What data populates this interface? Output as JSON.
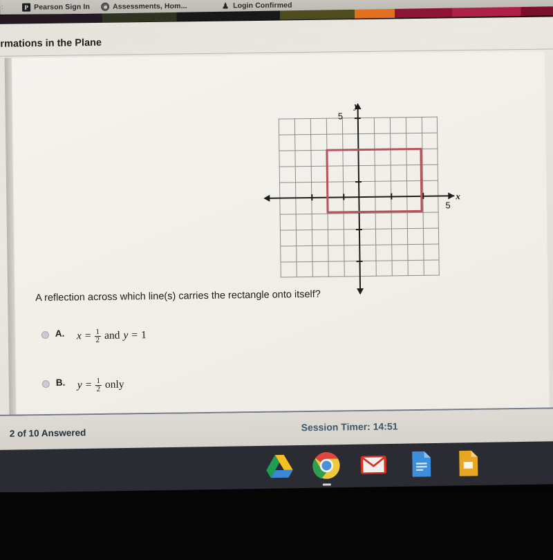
{
  "browser": {
    "tabs": [
      {
        "label": "Pearson Sign In",
        "favicon": "pearson-p-icon",
        "favicon_glyph": "P"
      },
      {
        "label": "Assessments, Hom...",
        "favicon": "globe-circle-icon",
        "favicon_glyph": ""
      },
      {
        "label": "Login Confirmed",
        "favicon": "person-icon",
        "favicon_glyph": "♟"
      }
    ]
  },
  "header": {
    "title": "rmations in the Plane"
  },
  "graph": {
    "y_axis_label": "y",
    "x_axis_label": "x",
    "y_tick_label": "5",
    "x_tick_label": "5",
    "grid_cells_x": 10,
    "grid_cells_y": 10,
    "rect_color": "#b5535c",
    "rect": {
      "x_min": -2,
      "x_max": 4,
      "y_min": -1,
      "y_max": 2
    }
  },
  "chart_data": {
    "type": "scatter",
    "title": "",
    "xlabel": "x",
    "ylabel": "y",
    "xlim": [
      -5,
      5
    ],
    "ylim": [
      -5,
      5
    ],
    "grid": true,
    "xticks": [
      5
    ],
    "yticks": [
      5
    ],
    "annotations": [
      "rectangle vertices: (-2,-1), (4,-1), (4,2), (-2,2)"
    ],
    "series": [
      {
        "name": "rectangle",
        "color": "#b5535c",
        "x": [
          -2,
          4,
          4,
          -2,
          -2
        ],
        "y": [
          -1,
          -1,
          2,
          2,
          -1
        ]
      }
    ]
  },
  "question": {
    "prompt": "A reflection across which line(s) carries the rectangle onto itself?",
    "choices": [
      {
        "letter": "A.",
        "selected": false,
        "parts": [
          {
            "var": "x"
          },
          {
            "op": "="
          },
          {
            "frac": [
              "1",
              "2"
            ]
          },
          {
            "text": "and"
          },
          {
            "var": "y"
          },
          {
            "op": "="
          },
          {
            "text": "1"
          }
        ]
      },
      {
        "letter": "B.",
        "selected": false,
        "parts": [
          {
            "var": "y"
          },
          {
            "op": "="
          },
          {
            "frac": [
              "1",
              "2"
            ]
          },
          {
            "text": "only"
          }
        ]
      }
    ]
  },
  "choice_a": {
    "letter": "A.",
    "var1": "x",
    "eq1": "=",
    "num1": "1",
    "den1": "2",
    "conj": "and",
    "var2": "y",
    "eq2": "=",
    "val2": "1"
  },
  "choice_b": {
    "letter": "B.",
    "var1": "y",
    "eq1": "=",
    "num1": "1",
    "den1": "2",
    "suffix": "only"
  },
  "footer": {
    "progress": "2 of 10 Answered",
    "timer": "Session Timer: 14:51"
  },
  "dock": {
    "items": [
      {
        "name": "google-drive-icon",
        "label": "Google Drive",
        "running": false
      },
      {
        "name": "google-chrome-icon",
        "label": "Google Chrome",
        "running": true
      },
      {
        "name": "gmail-icon",
        "label": "Gmail",
        "running": false
      },
      {
        "name": "google-docs-icon",
        "label": "Google Docs",
        "running": false
      },
      {
        "name": "google-slides-icon",
        "label": "Google Slides",
        "running": false
      }
    ]
  }
}
